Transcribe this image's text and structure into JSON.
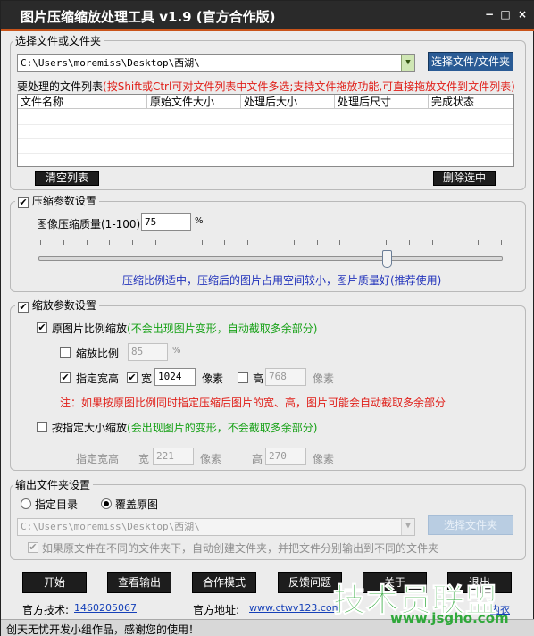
{
  "window": {
    "title": "图片压缩缩放处理工具 v1.9 (官方合作版)",
    "controls": [
      "−",
      "□",
      "×"
    ]
  },
  "file_select": {
    "group_title": "选择文件或文件夹",
    "path": "C:\\Users\\moremiss\\Desktop\\西湖\\",
    "browse_button": "选择文件/文件夹",
    "list_label": "要处理的文件列表",
    "list_hint": "(按Shift或Ctrl可对文件列表中文件多选;支持文件拖放功能,可直接拖放文件到文件列表)",
    "columns": [
      "文件名称",
      "原始文件大小",
      "处理后大小",
      "处理后尺寸",
      "完成状态"
    ],
    "clear_button": "清空列表",
    "delete_button": "删除选中"
  },
  "compression": {
    "group_title": "压缩参数设置",
    "enabled": true,
    "quality_label": "图像压缩质量(1-100):",
    "quality_value": "75",
    "quality_unit": "%",
    "quality_level": 0.75,
    "hint": "压缩比例适中，压缩后的图片占用空间较小，图片质量好(推荐使用)"
  },
  "scaling": {
    "group_title": "缩放参数设置",
    "enabled": true,
    "proportional": {
      "label": "原图片比例缩放",
      "note": "(不会出现图片变形，自动截取多余部分)",
      "checked": true
    },
    "ratio": {
      "label": "缩放比例",
      "value": "85",
      "unit": "%",
      "checked": false
    },
    "specify": {
      "label": "指定宽高",
      "checked": true
    },
    "width": {
      "label": "宽",
      "value": "1024",
      "unit": "像素",
      "checked": true
    },
    "height": {
      "label": "高",
      "value": "768",
      "unit": "像素",
      "checked": false
    },
    "warning": "注：如果按原图比例同时指定压缩后图片的宽、高，图片可能会自动截取多余部分",
    "fixed": {
      "label": "按指定大小缩放",
      "note": "(会出现图片的变形，不会截取多余部分)",
      "checked": false
    },
    "fixed_size": {
      "label": "指定宽高",
      "width_label": "宽",
      "width_value": "221",
      "width_unit": "像素",
      "height_label": "高",
      "height_value": "270",
      "height_unit": "像素"
    }
  },
  "output": {
    "group_title": "输出文件夹设置",
    "option_dir": "指定目录",
    "option_overwrite": "覆盖原图",
    "selected": "覆盖原图",
    "path": "C:\\Users\\moremiss\\Desktop\\西湖\\",
    "browse_button": "选择文件夹",
    "subfolder_label": "如果原文件在不同的文件夹下，自动创建文件夹，并把文件分别输出到不同的文件夹",
    "subfolder_checked": true
  },
  "actions": [
    "开始",
    "查看输出",
    "合作模式",
    "反馈问题",
    "关于",
    "退出"
  ],
  "footer": {
    "tech_label": "官方技术:",
    "tech_value": "1460205067",
    "site_label": "官方地址:",
    "site_value": "www.ctwv123.com",
    "partial_right": "内衣",
    "status": "创天无忧开发小组作品，感谢您的使用！"
  },
  "watermark": {
    "main": "技术员联盟",
    "url": "www.jsgho.com"
  },
  "colors": {
    "accent": "#c9541a",
    "button": "#1d1d1d",
    "hint_blue": "#2233bb",
    "warn_red": "#e0201a",
    "note_green": "#17a117",
    "watermark": "#2fa83a"
  }
}
